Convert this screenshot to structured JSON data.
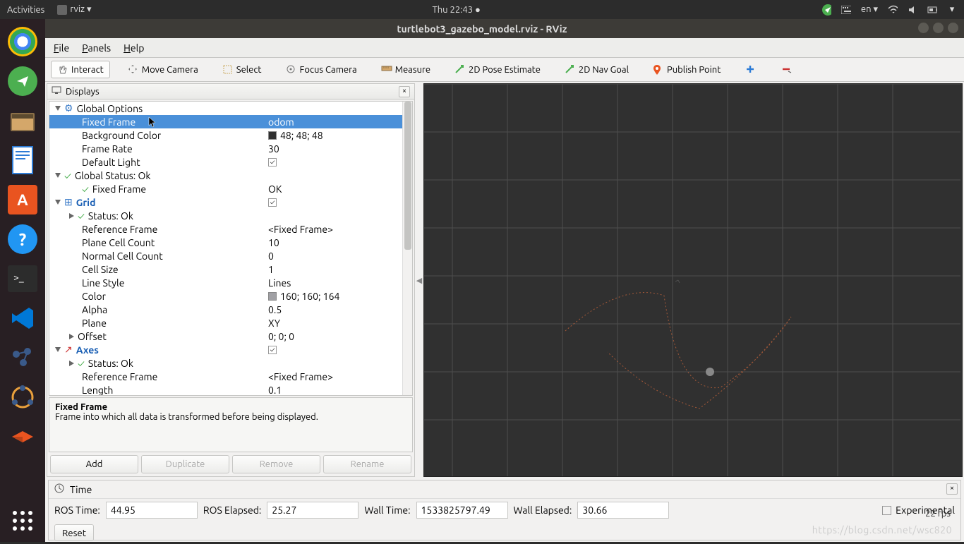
{
  "topbar": {
    "activities": "Activities",
    "app": "rviz ▾",
    "clock": "Thu 22:43 ●",
    "lang": "en ▾"
  },
  "window": {
    "title": "turtlebot3_gazebo_model.rviz - RViz"
  },
  "menu": {
    "file": "File",
    "panels": "Panels",
    "help": "Help"
  },
  "toolbar": {
    "interact": "Interact",
    "move_camera": "Move Camera",
    "select": "Select",
    "focus_camera": "Focus Camera",
    "measure": "Measure",
    "pose_estimate": "2D Pose Estimate",
    "nav_goal": "2D Nav Goal",
    "publish_point": "Publish Point"
  },
  "panel_displays": "Displays",
  "tree": {
    "global_options": "Global Options",
    "fixed_frame": "Fixed Frame",
    "fixed_frame_val": "odom",
    "bg_color": "Background Color",
    "bg_color_val": "48; 48; 48",
    "frame_rate": "Frame Rate",
    "frame_rate_val": "30",
    "default_light": "Default Light",
    "global_status": "Global Status: Ok",
    "ff_status": "Fixed Frame",
    "ff_status_val": "OK",
    "grid": "Grid",
    "status_ok": "Status: Ok",
    "ref_frame": "Reference Frame",
    "ref_frame_val": "<Fixed Frame>",
    "plane_cell": "Plane Cell Count",
    "plane_cell_val": "10",
    "normal_cell": "Normal Cell Count",
    "normal_cell_val": "0",
    "cell_size": "Cell Size",
    "cell_size_val": "1",
    "line_style": "Line Style",
    "line_style_val": "Lines",
    "color": "Color",
    "color_val": "160; 160; 164",
    "alpha": "Alpha",
    "alpha_val": "0.5",
    "plane": "Plane",
    "plane_val": "XY",
    "offset": "Offset",
    "offset_val": "0; 0; 0",
    "axes": "Axes",
    "axes_ref": "Reference Frame",
    "axes_ref_val": "<Fixed Frame>",
    "length": "Length",
    "length_val": "0.1"
  },
  "desc": {
    "title": "Fixed Frame",
    "body": "Frame into which all data is transformed before being displayed."
  },
  "buttons": {
    "add": "Add",
    "duplicate": "Duplicate",
    "remove": "Remove",
    "rename": "Rename"
  },
  "time": {
    "label": "Time",
    "ros_time_lbl": "ROS Time:",
    "ros_time": "44.95",
    "ros_elapsed_lbl": "ROS Elapsed:",
    "ros_elapsed": "25.27",
    "wall_time_lbl": "Wall Time:",
    "wall_time": "1533825797.49",
    "wall_elapsed_lbl": "Wall Elapsed:",
    "wall_elapsed": "30.66",
    "experimental": "Experimental",
    "reset": "Reset",
    "fps": "22 fps"
  },
  "watermark": "https://blog.csdn.net/wsc820"
}
